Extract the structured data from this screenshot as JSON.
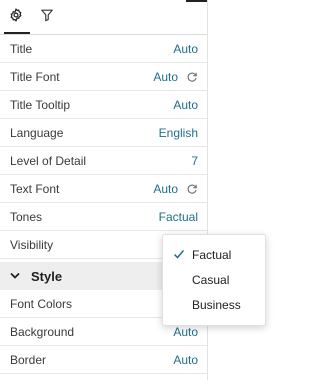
{
  "tabs": [
    {
      "icon": "gear-icon",
      "active": true
    },
    {
      "icon": "filter-icon",
      "active": false
    }
  ],
  "properties": [
    {
      "label": "Title",
      "value": "Auto",
      "reset": false
    },
    {
      "label": "Title Font",
      "value": "Auto",
      "reset": true
    },
    {
      "label": "Title Tooltip",
      "value": "Auto",
      "reset": false
    },
    {
      "label": "Language",
      "value": "English",
      "reset": false
    },
    {
      "label": "Level of Detail",
      "value": "7",
      "reset": false
    },
    {
      "label": "Text Font",
      "value": "Auto",
      "reset": true
    },
    {
      "label": "Tones",
      "value": "Factual",
      "reset": false
    },
    {
      "label": "Visibility",
      "value": "",
      "reset": false
    }
  ],
  "section": {
    "title": "Style",
    "expanded": true
  },
  "style_properties": [
    {
      "label": "Font Colors",
      "value": ""
    },
    {
      "label": "Background",
      "value": "Auto"
    },
    {
      "label": "Border",
      "value": "Auto"
    }
  ],
  "tones_dropdown": {
    "options": [
      {
        "label": "Factual",
        "selected": true
      },
      {
        "label": "Casual",
        "selected": false
      },
      {
        "label": "Business",
        "selected": false
      }
    ]
  },
  "colors": {
    "accent": "#1e6f8c"
  }
}
